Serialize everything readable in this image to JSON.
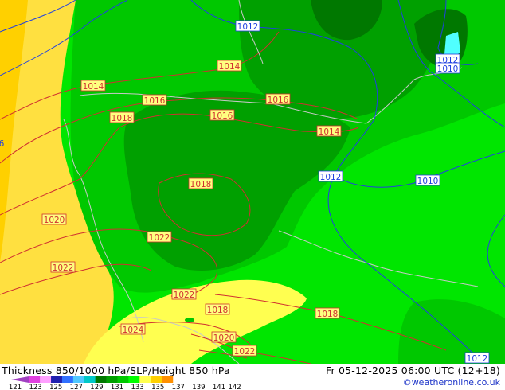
{
  "product_title": "Thickness 850/1000 hPa/SLP/Height 850 hPa",
  "valid_time": "Fr 05-12-2025 06:00 UTC (12+18)",
  "credit": "©weatheronline.co.uk",
  "legend": {
    "ticks": [
      "121",
      "123",
      "125",
      "127",
      "129",
      "131",
      "133",
      "135",
      "137",
      "139",
      "141",
      "142"
    ],
    "colors": [
      "#a040c0",
      "#e040e0",
      "#ffa0ff",
      "#2020b0",
      "#3070ff",
      "#50c8ff",
      "#00c8c8",
      "#007800",
      "#00a000",
      "#00c800",
      "#00ff00",
      "#ffff50",
      "#ffd000",
      "#ff9000"
    ]
  },
  "map_colors": {
    "warm_yellow": "#ffe040",
    "pale_yellow": "#ffff50",
    "green_bright": "#00e600",
    "green_mid": "#00c800",
    "green_dark": "#00a000",
    "green_darkest": "#007800",
    "cyan": "#50ffff",
    "isobar": "#d03030",
    "isoheight": "#2040e0",
    "coast": "#c8c8c8"
  },
  "isobar_labels": [
    {
      "text": "1012",
      "line": "blue"
    },
    {
      "text": "1014",
      "line": "red"
    },
    {
      "text": "1014",
      "line": "red"
    },
    {
      "text": "1016",
      "line": "red"
    },
    {
      "text": "1016",
      "line": "red"
    },
    {
      "text": "1016",
      "line": "red"
    },
    {
      "text": "1018",
      "line": "red"
    },
    {
      "text": "1014",
      "line": "red"
    },
    {
      "text": "1012",
      "line": "blue"
    },
    {
      "text": "1010",
      "line": "blue"
    },
    {
      "text": "1018",
      "line": "red"
    },
    {
      "text": "1020",
      "line": "red"
    },
    {
      "text": "1022",
      "line": "red"
    },
    {
      "text": "1022",
      "line": "red"
    },
    {
      "text": "1022",
      "line": "red"
    },
    {
      "text": "1018",
      "line": "red"
    },
    {
      "text": "1018",
      "line": "red"
    },
    {
      "text": "1024",
      "line": "red"
    },
    {
      "text": "1020",
      "line": "red"
    },
    {
      "text": "1022",
      "line": "red"
    },
    {
      "text": "1012",
      "line": "blue"
    },
    {
      "text": "1012",
      "line": "blue"
    },
    {
      "text": "1010",
      "line": "blue"
    },
    {
      "text": "6",
      "line": "blue"
    }
  ]
}
